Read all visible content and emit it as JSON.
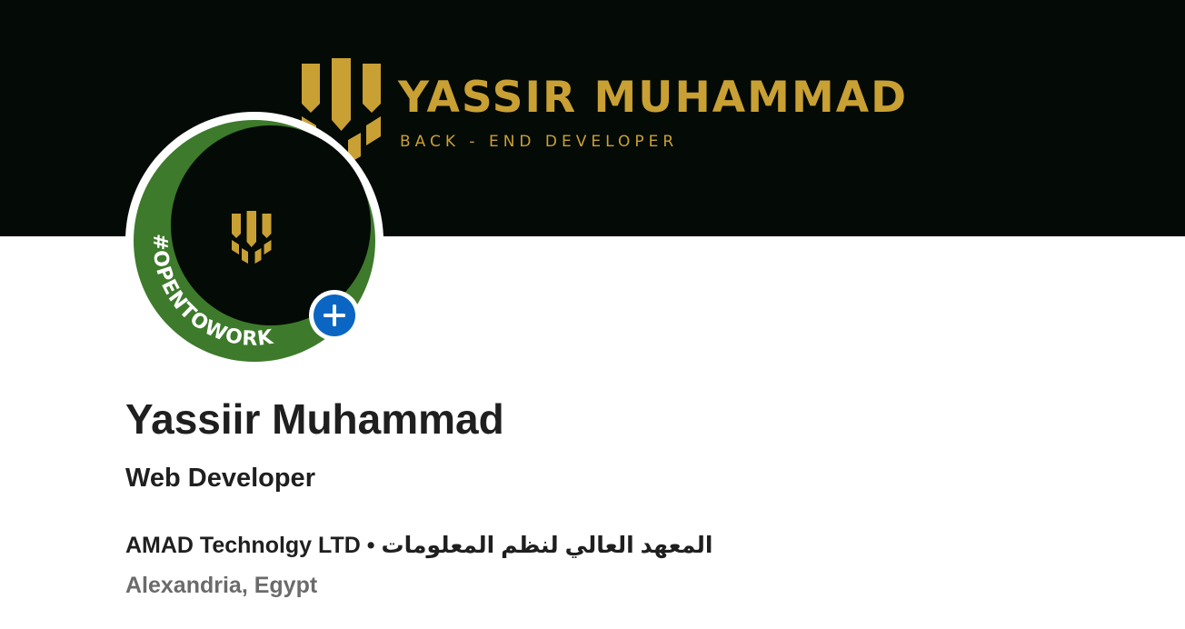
{
  "banner": {
    "name": "YASSIR MUHAMMAD",
    "subtitle": "BACK - END DEVELOPER",
    "logo_icon": "trident-logo-icon",
    "brand_color": "#c9a033",
    "background_color": "#040a06"
  },
  "avatar": {
    "badge_text": "#OPENTOWORK",
    "badge_color": "#3d7a2b",
    "add_icon": "plus-icon",
    "add_button_color": "#0a66c2"
  },
  "profile": {
    "name": "Yassiir Muhammad",
    "headline": "Web Developer",
    "company": "AMAD Technolgy LTD",
    "separator": "•",
    "school": "المعهد العالي لنظم المعلومات",
    "location": "Alexandria, Egypt"
  }
}
